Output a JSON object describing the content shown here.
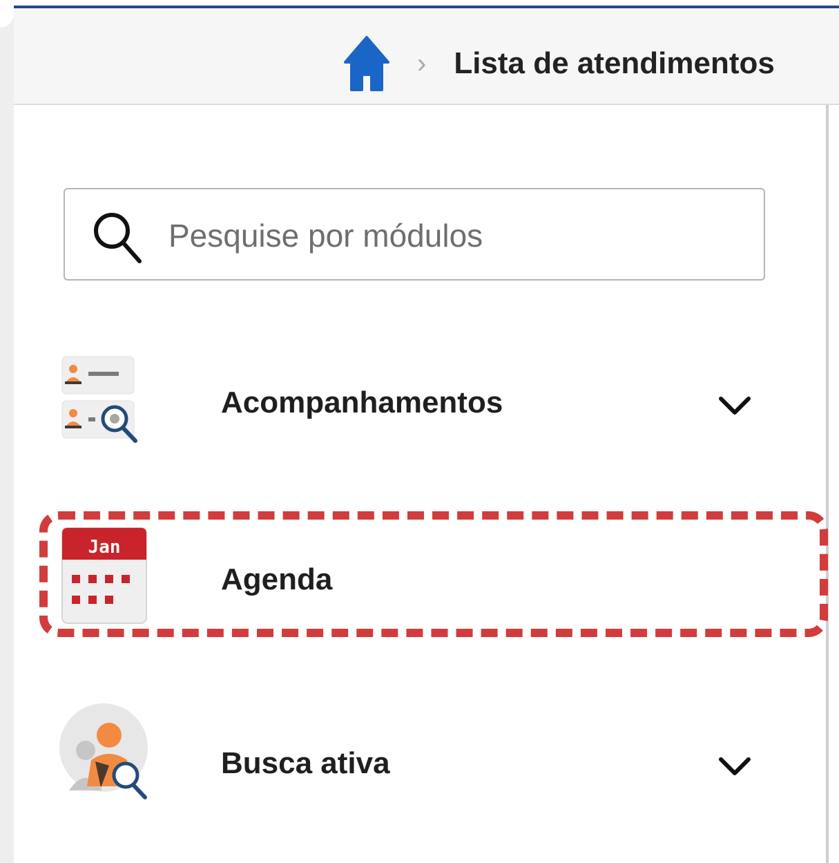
{
  "header": {
    "breadcrumb_title": "Lista de atendimentos"
  },
  "search": {
    "placeholder": "Pesquise por módulos"
  },
  "menu": {
    "items": [
      {
        "label": "Acompanhamentos",
        "icon": "user-list-search-icon",
        "expandable": true
      },
      {
        "label": "Agenda",
        "icon": "calendar-icon",
        "calendar_month": "Jan",
        "expandable": false,
        "highlighted": true
      },
      {
        "label": "Busca ativa",
        "icon": "active-search-person-icon",
        "expandable": true
      }
    ]
  },
  "colors": {
    "accent_blue": "#1a66c7",
    "header_border": "#234a86",
    "highlight_red": "#d23c3c",
    "calendar_red": "#c9242b",
    "person_orange": "#f28a42"
  }
}
